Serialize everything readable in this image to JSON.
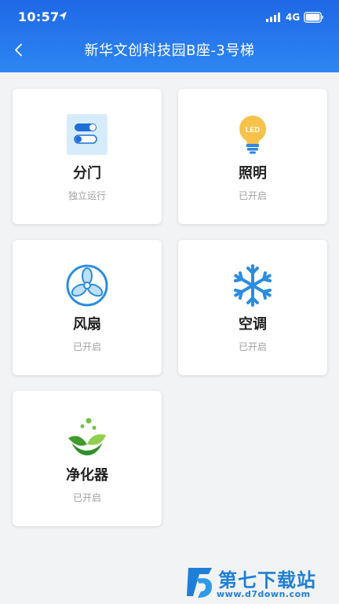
{
  "status_bar": {
    "time": "10:57",
    "network": "4G"
  },
  "nav": {
    "title": "新华文创科技园B座-3号梯",
    "back_icon": "chevron-left-icon"
  },
  "devices": [
    {
      "name": "分门",
      "status": "独立运行",
      "icon": "toggle-switch-icon"
    },
    {
      "name": "照明",
      "status": "已开启",
      "icon": "led-bulb-icon",
      "icon_text": "LED"
    },
    {
      "name": "风扇",
      "status": "已开启",
      "icon": "fan-icon"
    },
    {
      "name": "空调",
      "status": "已开启",
      "icon": "snowflake-icon"
    },
    {
      "name": "净化器",
      "status": "已开启",
      "icon": "leaf-purifier-icon"
    }
  ],
  "watermark": {
    "text": "第七下载站",
    "url": "www.d7down.com"
  },
  "colors": {
    "header_top": "#1f68e6",
    "header_bottom": "#2d86f2",
    "card_bg": "#ffffff",
    "page_bg": "#f2f3f5",
    "accent_blue": "#2a8de0",
    "bulb_yellow": "#f6c24a",
    "leaf_green": "#5cb531",
    "watermark_blue": "#1f7fd6"
  }
}
